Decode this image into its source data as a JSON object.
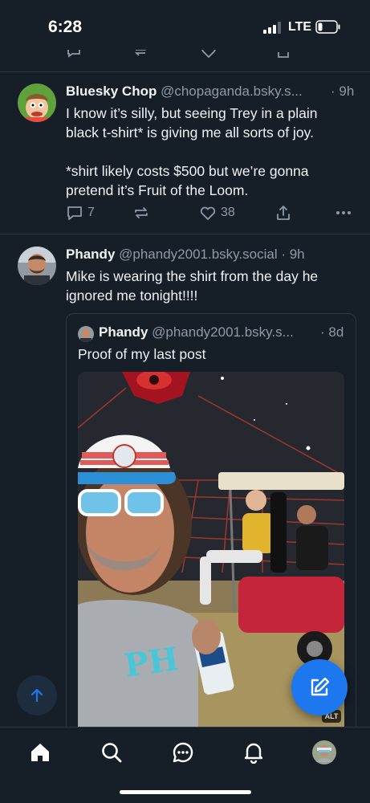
{
  "status_bar": {
    "time": "6:28",
    "network": "LTE",
    "signal_bars": 3,
    "battery_level": 0.2
  },
  "posts": [
    {
      "author": "Bluesky Chop",
      "handle": "@chopaganda.bsky.s...",
      "time": "· 9h",
      "text_lines": [
        "I know it’s silly, but seeing Trey in a plain",
        "black t-shirt* is giving me all sorts of joy.",
        "",
        "*shirt likely costs $500 but we’re gonna",
        "pretend it’s Fruit of the Loom."
      ],
      "reply_count": "7",
      "like_count": "38"
    },
    {
      "author": "Phandy",
      "handle": "@phandy2001.bsky.social",
      "time": "· 9h",
      "text_lines": [
        "Mike is wearing the shirt from the day he",
        "ignored me tonight!!!!"
      ],
      "quote": {
        "author": "Phandy",
        "handle": "@phandy2001.bsky.s...",
        "time": "· 8d",
        "text": "Proof of my last post",
        "alt_badge": "ALT"
      }
    }
  ],
  "icons": {
    "reply": "reply-icon",
    "repost": "repost-icon",
    "like": "heart-icon",
    "share": "share-icon",
    "more": "more-icon",
    "compose": "compose-icon",
    "scroll_top": "arrow-up-icon"
  },
  "tabs": [
    "home-icon",
    "search-icon",
    "chat-icon",
    "bell-icon",
    "profile-avatar"
  ],
  "colors": {
    "background": "#161e27",
    "accent": "#1d78f0",
    "muted": "#8d9aa8",
    "divider": "#2b3743"
  }
}
